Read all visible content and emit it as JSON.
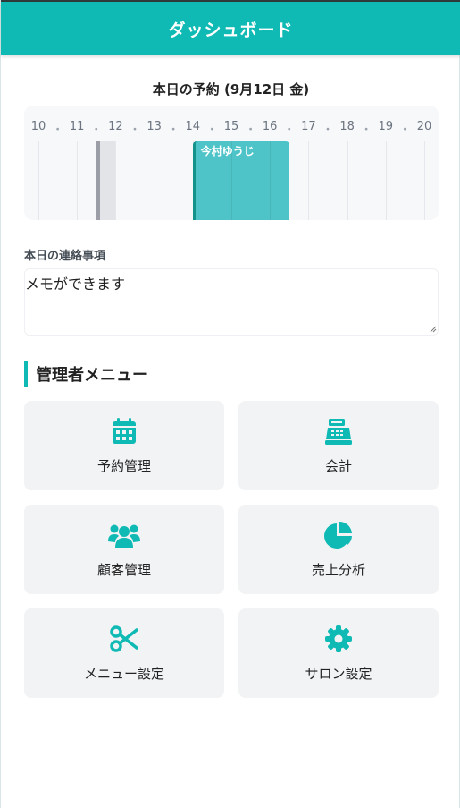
{
  "header": {
    "title": "ダッシュボード"
  },
  "schedule": {
    "title": "本日の予約 (9月12日 金)",
    "separator": "・",
    "hours": [
      "10",
      "11",
      "12",
      "13",
      "14",
      "15",
      "16",
      "17",
      "18",
      "19",
      "20"
    ],
    "appointments": [
      {
        "name": "今村ゆうじ",
        "start_hour": 14.0,
        "end_hour": 16.5,
        "color": "#4fc4c8"
      }
    ],
    "blocked": {
      "start_hour": 11.5,
      "end_hour": 12.0
    }
  },
  "memo": {
    "label": "本日の連絡事項",
    "value": "メモができます"
  },
  "admin": {
    "title": "管理者メニュー",
    "items": [
      {
        "label": "予約管理",
        "icon": "calendar-icon"
      },
      {
        "label": "会計",
        "icon": "cash-register-icon"
      },
      {
        "label": "顧客管理",
        "icon": "users-icon"
      },
      {
        "label": "売上分析",
        "icon": "pie-chart-icon"
      },
      {
        "label": "メニュー設定",
        "icon": "scissors-icon"
      },
      {
        "label": "サロン設定",
        "icon": "gear-icon"
      }
    ]
  },
  "colors": {
    "accent": "#0fbab4",
    "appointment": "#4fc4c8",
    "card_bg": "#f2f3f5"
  }
}
